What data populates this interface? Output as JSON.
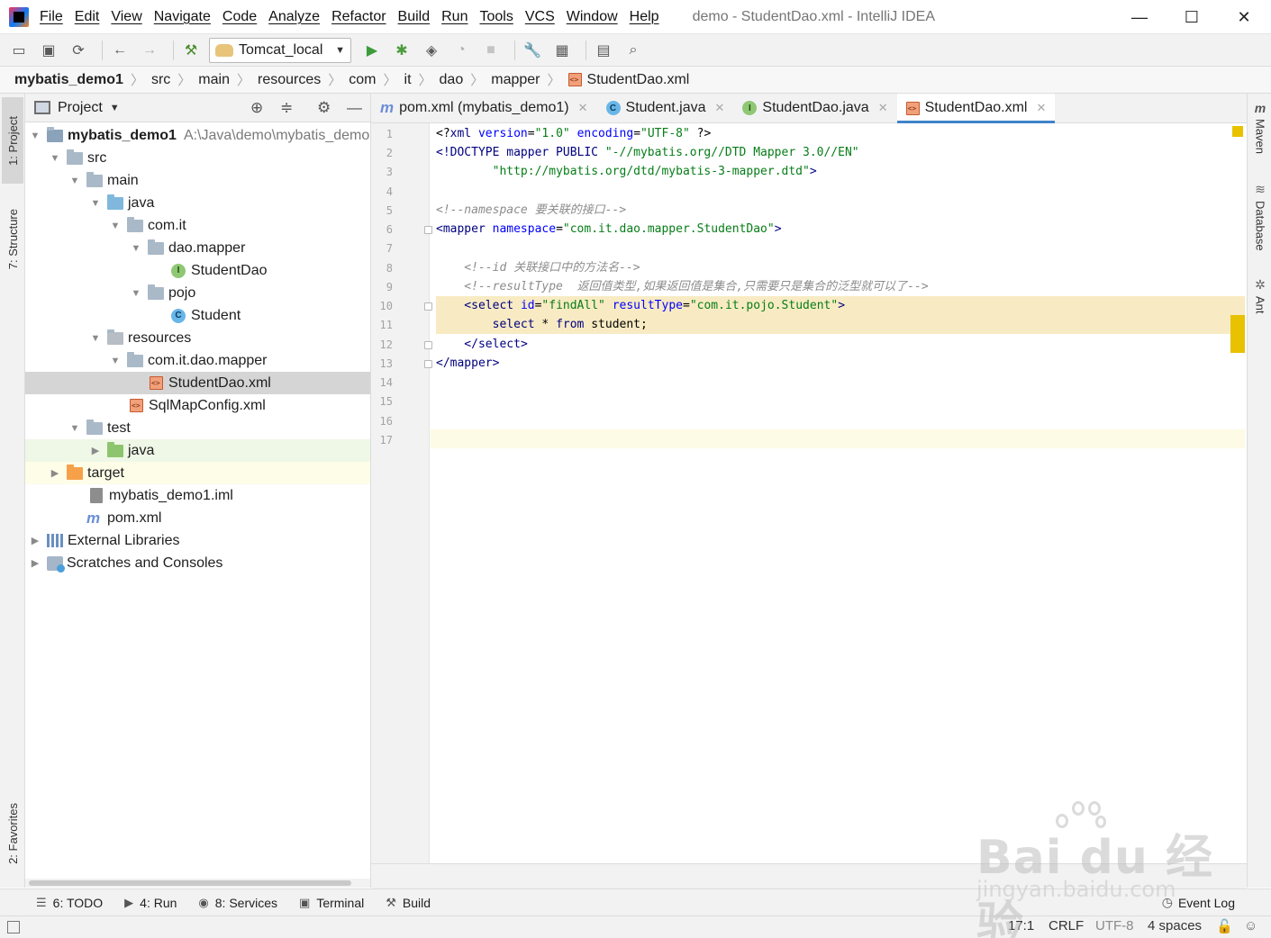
{
  "window": {
    "title": "demo - StudentDao.xml - IntelliJ IDEA",
    "menu": [
      "File",
      "Edit",
      "View",
      "Navigate",
      "Code",
      "Analyze",
      "Refactor",
      "Build",
      "Run",
      "Tools",
      "VCS",
      "Window",
      "Help"
    ],
    "controls": {
      "minimize": "—",
      "maximize": "☐",
      "close": "✕"
    }
  },
  "toolbar": {
    "run_config": "Tomcat_local"
  },
  "breadcrumb": [
    "mybatis_demo1",
    "src",
    "main",
    "resources",
    "com",
    "it",
    "dao",
    "mapper",
    "StudentDao.xml"
  ],
  "left_stripe": {
    "project": "1: Project",
    "structure": "7: Structure",
    "favorites": "2: Favorites"
  },
  "project_panel": {
    "title": "Project",
    "tree": [
      {
        "label": "mybatis_demo1",
        "hint": "A:\\Java\\demo\\mybatis_demo"
      },
      {
        "label": "src"
      },
      {
        "label": "main"
      },
      {
        "label": "java"
      },
      {
        "label": "com.it"
      },
      {
        "label": "dao.mapper"
      },
      {
        "label": "StudentDao",
        "badge": "I"
      },
      {
        "label": "pojo"
      },
      {
        "label": "Student",
        "badge": "C"
      },
      {
        "label": "resources"
      },
      {
        "label": "com.it.dao.mapper"
      },
      {
        "label": "StudentDao.xml"
      },
      {
        "label": "SqlMapConfig.xml"
      },
      {
        "label": "test"
      },
      {
        "label": "java"
      },
      {
        "label": "target"
      },
      {
        "label": "mybatis_demo1.iml"
      },
      {
        "label": "pom.xml",
        "badge": "m"
      },
      {
        "label": "External Libraries"
      },
      {
        "label": "Scratches and Consoles"
      }
    ]
  },
  "editor_tabs": [
    {
      "label": "pom.xml (mybatis_demo1)",
      "badge": "m"
    },
    {
      "label": "Student.java",
      "badge": "C"
    },
    {
      "label": "StudentDao.java",
      "badge": "I"
    },
    {
      "label": "StudentDao.xml"
    }
  ],
  "tab_close": "✕",
  "line_numbers": [
    "1",
    "2",
    "3",
    "4",
    "5",
    "6",
    "7",
    "8",
    "9",
    "10",
    "11",
    "12",
    "13",
    "14",
    "15",
    "16",
    "17"
  ],
  "code": {
    "l1": {
      "a": "<?",
      "b": "xml ",
      "c": "version",
      "d": "=",
      "e": "\"1.0\"",
      "f": " ",
      "g": "encoding",
      "h": "=",
      "i": "\"UTF-8\"",
      "j": " ?>"
    },
    "l2": {
      "a": "<!DOCTYPE mapper PUBLIC ",
      "b": "\"-//mybatis.org//DTD Mapper 3.0//EN\""
    },
    "l3": {
      "a": "        ",
      "b": "\"http://mybatis.org/dtd/mybatis-3-mapper.dtd\"",
      "c": ">"
    },
    "l5": "<!--namespace 要关联的接口-->",
    "l6": {
      "a": "<",
      "b": "mapper ",
      "c": "namespace",
      "d": "=",
      "e": "\"com.it.dao.mapper.StudentDao\"",
      "f": ">"
    },
    "l8": "    <!--id 关联接口中的方法名-->",
    "l9": "    <!--resultType  返回值类型,如果返回值是集合,只需要只是集合的泛型就可以了-->",
    "l10": {
      "a": "    <",
      "b": "select ",
      "c": "id",
      "d": "=",
      "e": "\"findAll\"",
      "f": " ",
      "g": "resultType",
      "h": "=",
      "i": "\"com.it.pojo.Student\"",
      "j": ">"
    },
    "l11": {
      "a": "        ",
      "b": "select",
      "c": " * ",
      "d": "from",
      "e": " student;"
    },
    "l12": {
      "a": "    </",
      "b": "select",
      "c": ">"
    },
    "l13": {
      "a": "</",
      "b": "mapper",
      "c": ">"
    }
  },
  "right_stripe": {
    "maven": "Maven",
    "database": "Database",
    "ant": "Ant"
  },
  "bottom_tools": [
    {
      "label": "6: TODO"
    },
    {
      "label": "4: Run"
    },
    {
      "label": "8: Services"
    },
    {
      "label": "Terminal"
    },
    {
      "label": "Build"
    }
  ],
  "event_log": "Event Log",
  "status": {
    "position": "17:1",
    "line_sep": "CRLF",
    "encoding": "UTF-8",
    "indent": "4 spaces"
  },
  "watermark": {
    "brand": "Bai du 经验",
    "url": "jingyan.baidu.com"
  },
  "colors": {
    "accent": "#4083c9",
    "selection_highlight": "#f8ebc3",
    "warning_marker": "#e8c100"
  }
}
